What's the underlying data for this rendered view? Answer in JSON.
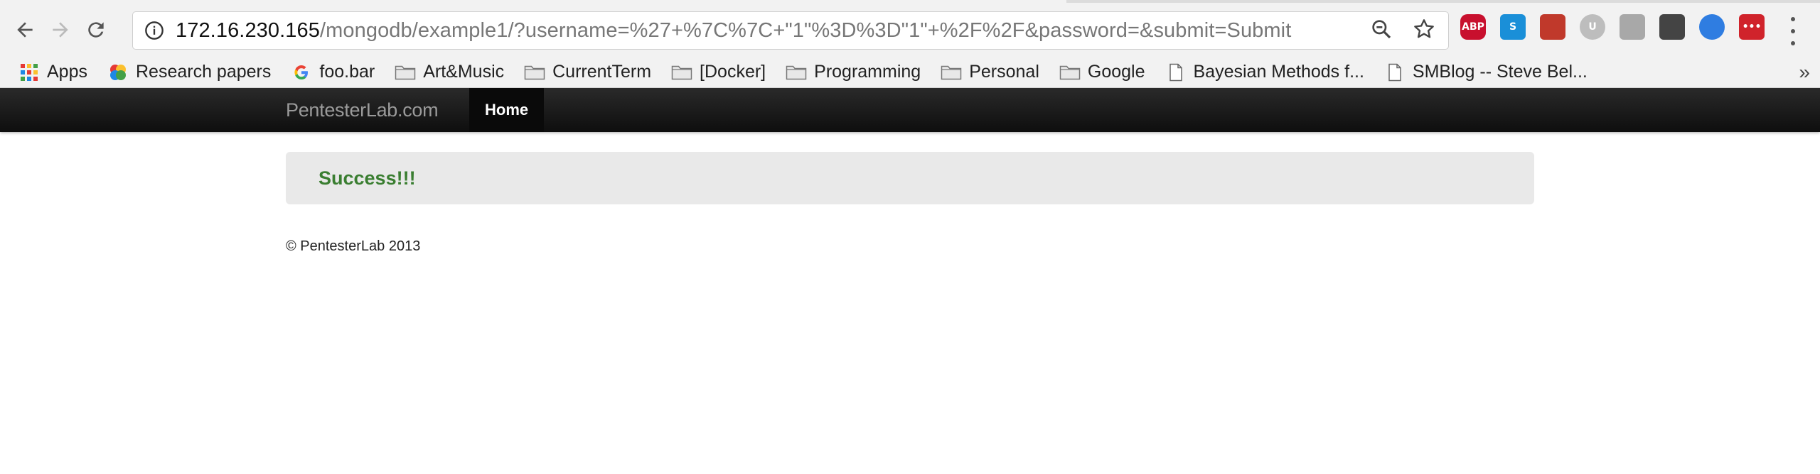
{
  "browser": {
    "url_host": "172.16.230.165",
    "url_path": "/mongodb/example1/?username=%27+%7C%7C+\"1\"%3D%3D\"1\"+%2F%2F&password=&submit=Submit",
    "extensions": [
      {
        "name": "adblock-plus-icon",
        "label": "ABP",
        "color": "#c8102e"
      },
      {
        "name": "skype-icon",
        "label": "S",
        "color": "#1a8fd8"
      },
      {
        "name": "reader-icon",
        "label": "",
        "color": "#c0392b"
      },
      {
        "name": "ublock-icon",
        "label": "U",
        "color": "#bdbdbd"
      },
      {
        "name": "drive-icon",
        "label": "",
        "color": "#a8a8a8"
      },
      {
        "name": "lightbulb-icon",
        "label": "",
        "color": "#444444"
      },
      {
        "name": "circle-app-icon",
        "label": "",
        "color": "#2f7de1"
      },
      {
        "name": "lastpass-icon",
        "label": "•••",
        "color": "#d0232b"
      }
    ]
  },
  "bookmarks": [
    {
      "label": "Apps",
      "icon": "apps-grid-icon"
    },
    {
      "label": "Research papers",
      "icon": "research-icon"
    },
    {
      "label": "foo.bar",
      "icon": "google-icon"
    },
    {
      "label": "Art&Music",
      "icon": "folder-icon"
    },
    {
      "label": "CurrentTerm",
      "icon": "folder-icon"
    },
    {
      "label": "[Docker]",
      "icon": "folder-icon"
    },
    {
      "label": "Programming",
      "icon": "folder-icon"
    },
    {
      "label": "Personal",
      "icon": "folder-icon"
    },
    {
      "label": "Google",
      "icon": "folder-icon"
    },
    {
      "label": "Bayesian Methods f...",
      "icon": "page-icon"
    },
    {
      "label": "SMBlog -- Steve Bel...",
      "icon": "page-icon"
    }
  ],
  "bookmarks_more": "»",
  "site": {
    "brand": "PentesterLab.com",
    "nav_home": "Home",
    "alert_message": "Success!!!",
    "footer": "© PentesterLab 2013"
  }
}
